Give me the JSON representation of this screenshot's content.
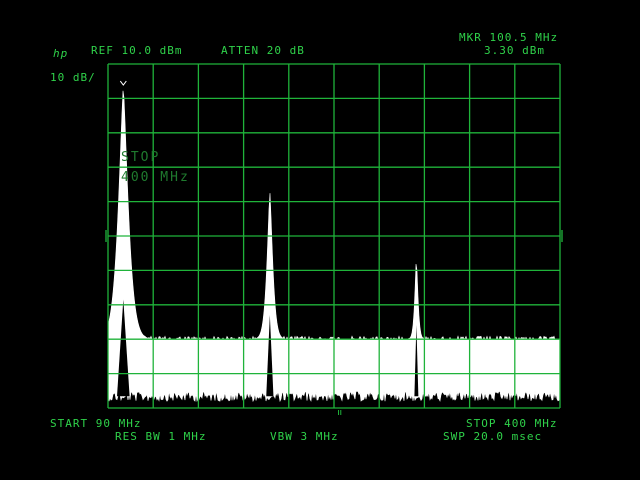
{
  "logo": "hp",
  "scale_per_div": "10 dB/",
  "ref_level": "REF 10.0 dBm",
  "attenuation": "ATTEN 20 dB",
  "marker": {
    "freq": "MKR 100.5 MHz",
    "level": "3.30 dBm"
  },
  "overlay": {
    "line1": "STOP",
    "line2": "400 MHz"
  },
  "start_freq": "START 90 MHz",
  "stop_freq": "STOP 400 MHz",
  "res_bw": "RES BW 1 MHz",
  "vbw": "VBW 3 MHz",
  "sweep": "SWP 20.0 msec",
  "colors": {
    "graticule": "#1fb33a",
    "text": "#2fd24a",
    "trace": "#ffffff",
    "background": "#000000"
  },
  "chart_data": {
    "type": "line",
    "x_unit": "MHz",
    "y_unit": "dBm",
    "xlim": [
      90,
      400
    ],
    "ylim": [
      -90,
      10
    ],
    "grid": true,
    "noise_floor_dBm": [
      -70,
      -86
    ],
    "peaks": [
      {
        "freq_MHz": 100.5,
        "level_dBm": 3.3
      },
      {
        "freq_MHz": 201,
        "level_dBm": -27
      },
      {
        "freq_MHz": 301.5,
        "level_dBm": -46
      }
    ]
  }
}
